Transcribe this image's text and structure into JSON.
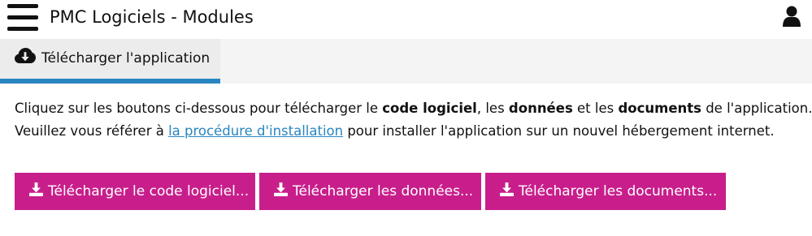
{
  "header": {
    "menu_icon": "hamburger-menu-icon",
    "title": "PMC Logiciels - Modules",
    "user_icon": "user-icon"
  },
  "tabs": [
    {
      "label": "Télécharger l'application",
      "icon": "cloud-download-icon",
      "active": true
    }
  ],
  "colors": {
    "accent": "#2a86c0",
    "button": "#c81e8b",
    "tabbar_bg": "#f4f4f4",
    "active_tab_bg": "#ececec"
  },
  "instructions": {
    "line1_part1": "Cliquez sur les boutons ci-dessous pour télécharger le ",
    "line1_bold1": "code logiciel",
    "line1_part2": ", les ",
    "line1_bold2": "données",
    "line1_part3": " et les ",
    "line1_bold3": "documents",
    "line1_part4": " de l'application.",
    "line2_part1": "Veuillez vous référer à ",
    "line2_link": "la procédure d'installation",
    "line2_part2": " pour installer l'application sur un nouvel hébergement internet."
  },
  "buttons": [
    {
      "label": "Télécharger le code logiciel...",
      "icon": "download-icon"
    },
    {
      "label": "Télécharger les données...",
      "icon": "download-icon"
    },
    {
      "label": "Télécharger les documents...",
      "icon": "download-icon"
    }
  ]
}
